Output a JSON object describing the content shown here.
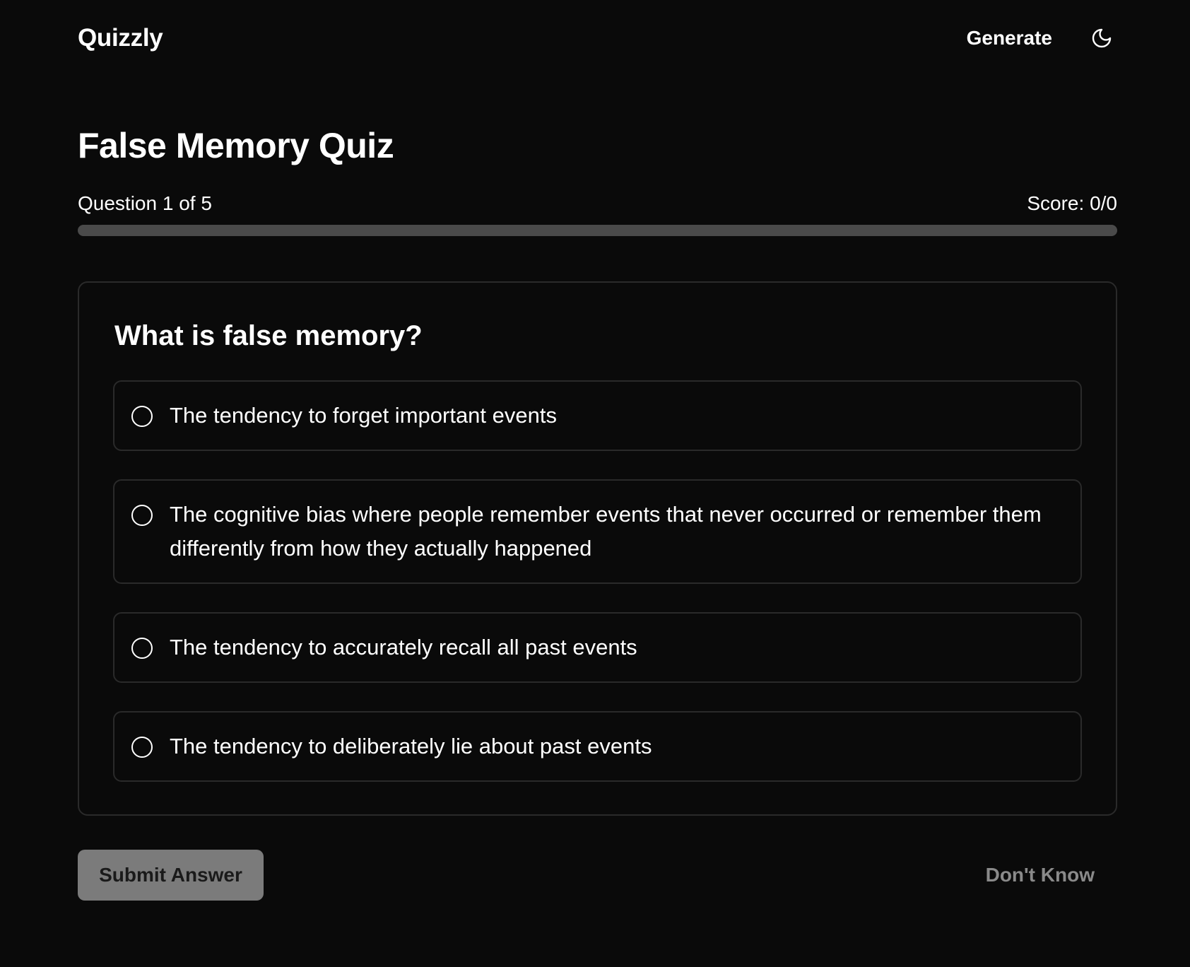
{
  "header": {
    "brand": "Quizzly",
    "nav_generate": "Generate",
    "theme_icon": "moon-icon"
  },
  "quiz": {
    "title": "False Memory Quiz",
    "progress_label": "Question 1 of 5",
    "score_label": "Score: 0/0",
    "progress_fraction": 0
  },
  "question": {
    "text": "What is false memory?",
    "options": [
      {
        "label": "The tendency to forget important events"
      },
      {
        "label": "The cognitive bias where people remember events that never occurred or remember them differently from how they actually happened"
      },
      {
        "label": "The tendency to accurately recall all past events"
      },
      {
        "label": "The tendency to deliberately lie about past events"
      }
    ]
  },
  "actions": {
    "submit_label": "Submit Answer",
    "dont_know_label": "Don't Know"
  },
  "colors": {
    "background": "#0a0a0a",
    "text": "#ffffff",
    "border": "#2a2a2a",
    "track": "#4a4a4a",
    "submit_disabled": "#7b7b7b",
    "muted": "#8a8a8a"
  }
}
